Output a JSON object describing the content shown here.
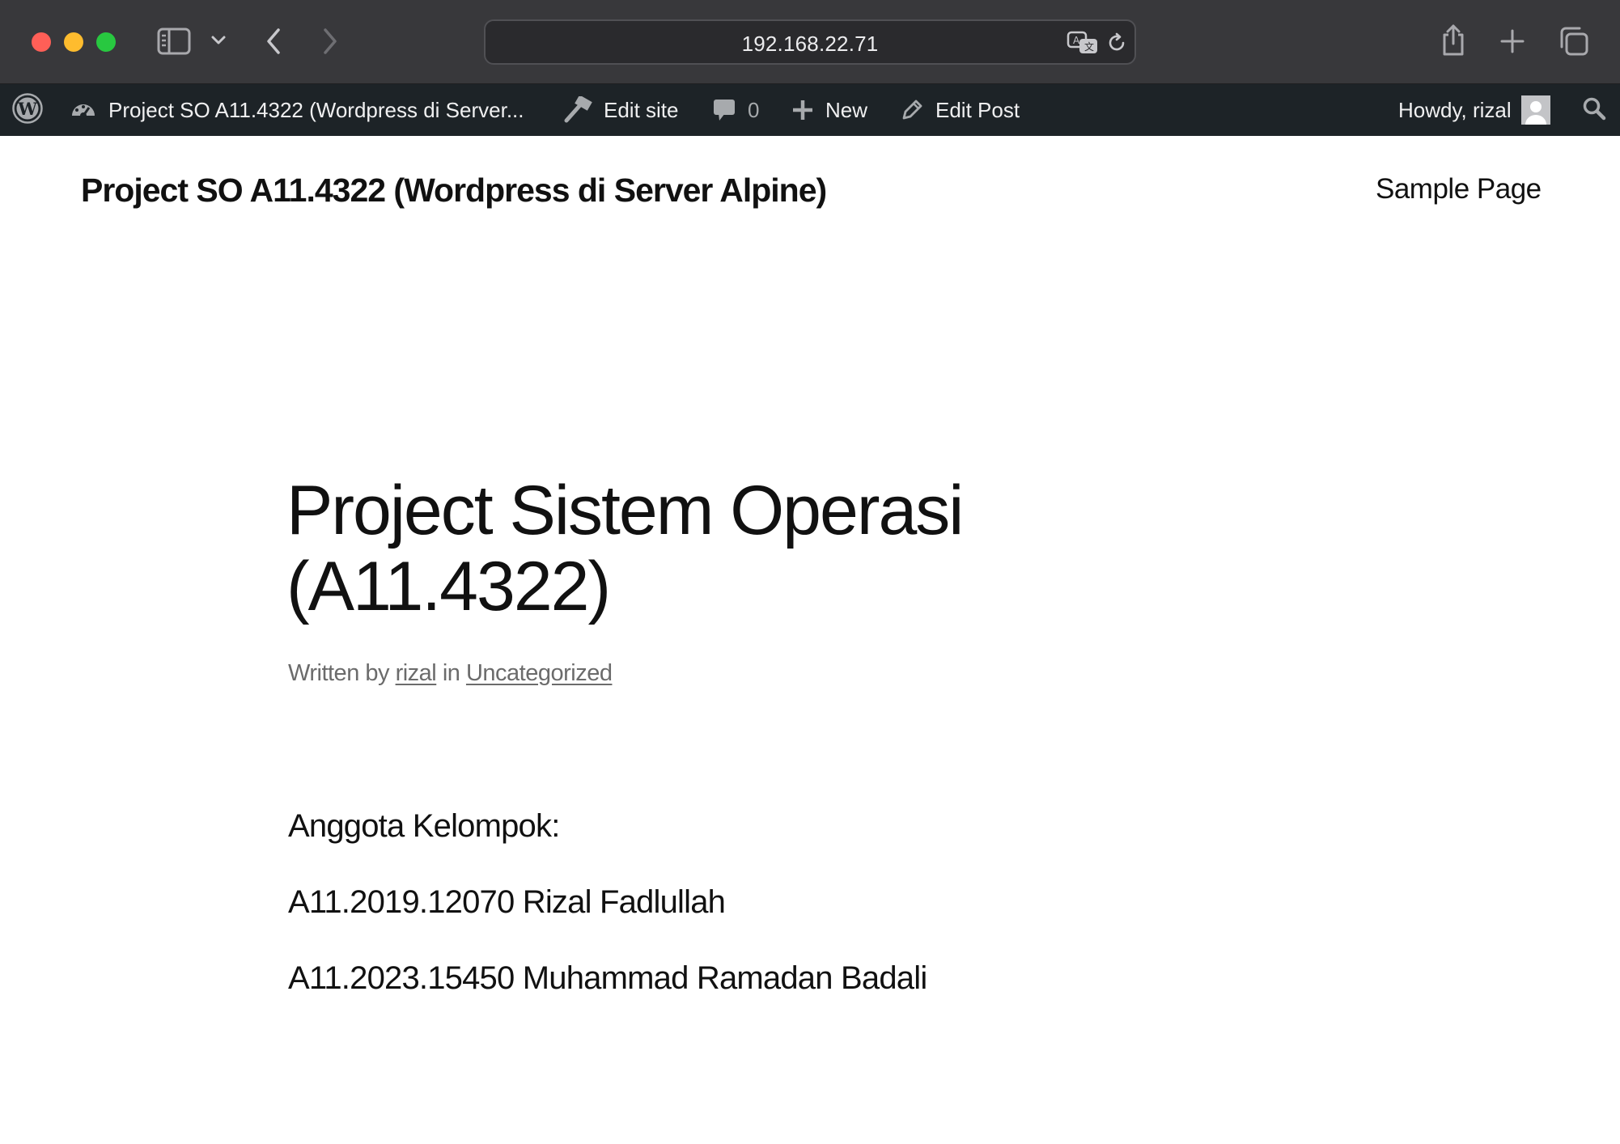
{
  "browser": {
    "url": "192.168.22.71",
    "icons": {
      "close": "close-dot",
      "minimize": "minimize-dot",
      "zoom": "zoom-dot",
      "sidebar": "sidebar-icon",
      "tab_group": "chevron-down-icon",
      "back": "chevron-left-icon",
      "forward": "chevron-right-icon",
      "translate": "translate-icon",
      "reload": "reload-icon",
      "share": "share-icon",
      "new_tab": "plus-icon",
      "tabs_overview": "tabs-overview-icon"
    }
  },
  "admin_bar": {
    "site_name": "Project SO A11.4322 (Wordpress di Server...",
    "edit_site": "Edit site",
    "comments_count": "0",
    "new": "New",
    "edit_post": "Edit Post",
    "howdy": "Howdy, rizal"
  },
  "site": {
    "title": "Project SO A11.4322 (Wordpress di Server Alpine)",
    "nav": [
      "Sample Page"
    ]
  },
  "post": {
    "title_line1": "Project Sistem Operasi",
    "title_line2": "(A11.4322)",
    "meta": {
      "written_by": "Written by",
      "author": "rizal",
      "in": "in",
      "category": "Uncategorized"
    },
    "content": [
      "Anggota Kelompok:",
      "A11.2019.12070 Rizal Fadlullah",
      "A11.2023.15450 Muhammad Ramadan Badali"
    ]
  },
  "colors": {
    "titlebar": "#38383b",
    "admin_bar": "#1d2327",
    "text": "#111111",
    "meta_text": "#6b6b6b"
  }
}
